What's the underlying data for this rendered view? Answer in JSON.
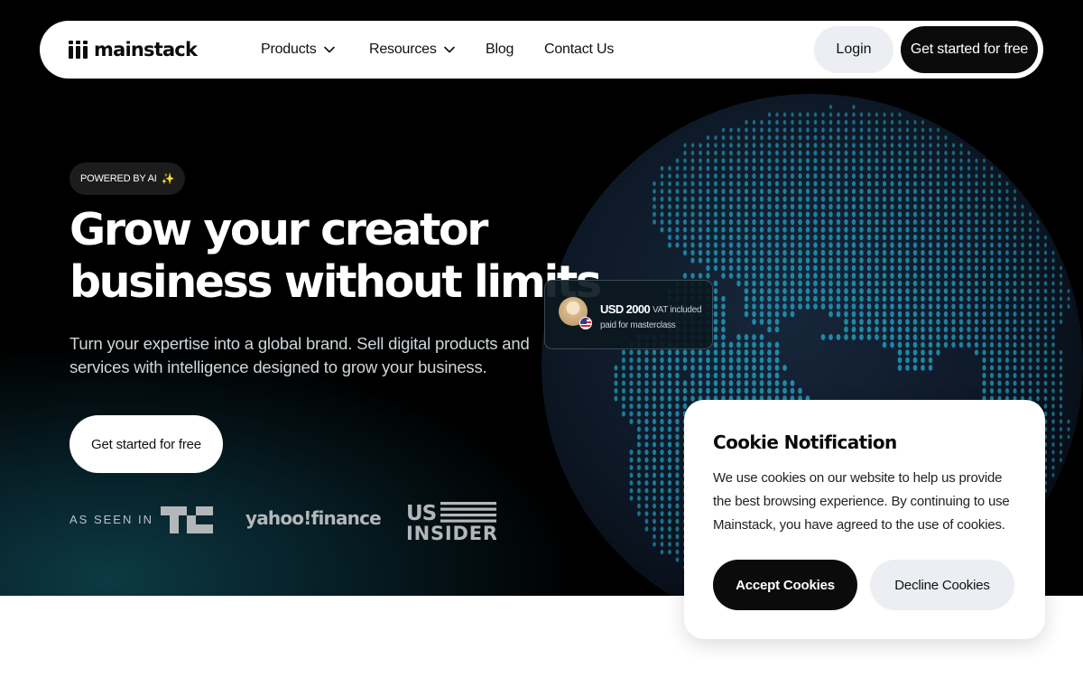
{
  "nav": {
    "logo_text": "mainstack",
    "items": [
      {
        "label": "Products",
        "has_dropdown": true
      },
      {
        "label": "Resources",
        "has_dropdown": true
      },
      {
        "label": "Blog",
        "has_dropdown": false
      },
      {
        "label": "Contact Us",
        "has_dropdown": false
      }
    ],
    "login_label": "Login",
    "cta_label": "Get started for free"
  },
  "hero": {
    "badge": "POWERED BY AI",
    "badge_icon": "sparkles-icon",
    "headline_line1": "Grow your creator",
    "headline_line2": "business without limits",
    "subtext": "Turn your expertise into a global brand. Sell digital products and services with intelligence designed to grow your business.",
    "cta_label": "Get started for free",
    "as_seen_in_label": "AS SEEN IN",
    "press_logos": [
      {
        "name": "TC",
        "icon": "techcrunch-logo"
      },
      {
        "name": "yahoo!finance",
        "icon": "yahoo-finance-logo"
      },
      {
        "name": "US INSIDER",
        "icon": "us-insider-logo"
      }
    ]
  },
  "payment_card": {
    "amount": "USD 2000",
    "vat_note": "VAT included",
    "description": "paid for masterclass",
    "flag": "us-flag-icon"
  },
  "cookie": {
    "title": "Cookie Notification",
    "text": "We use cookies on our website to help us provide the best browsing experience. By continuing to use Mainstack, you have agreed to the use of cookies.",
    "accept_label": "Accept Cookies",
    "decline_label": "Decline Cookies"
  },
  "colors": {
    "hero_bg": "#000000",
    "globe_dots": "#1f8aa8",
    "globe_sphere": "#0f1b2a",
    "primary_button": "#0b0b0b",
    "secondary_button": "#eceef3"
  }
}
